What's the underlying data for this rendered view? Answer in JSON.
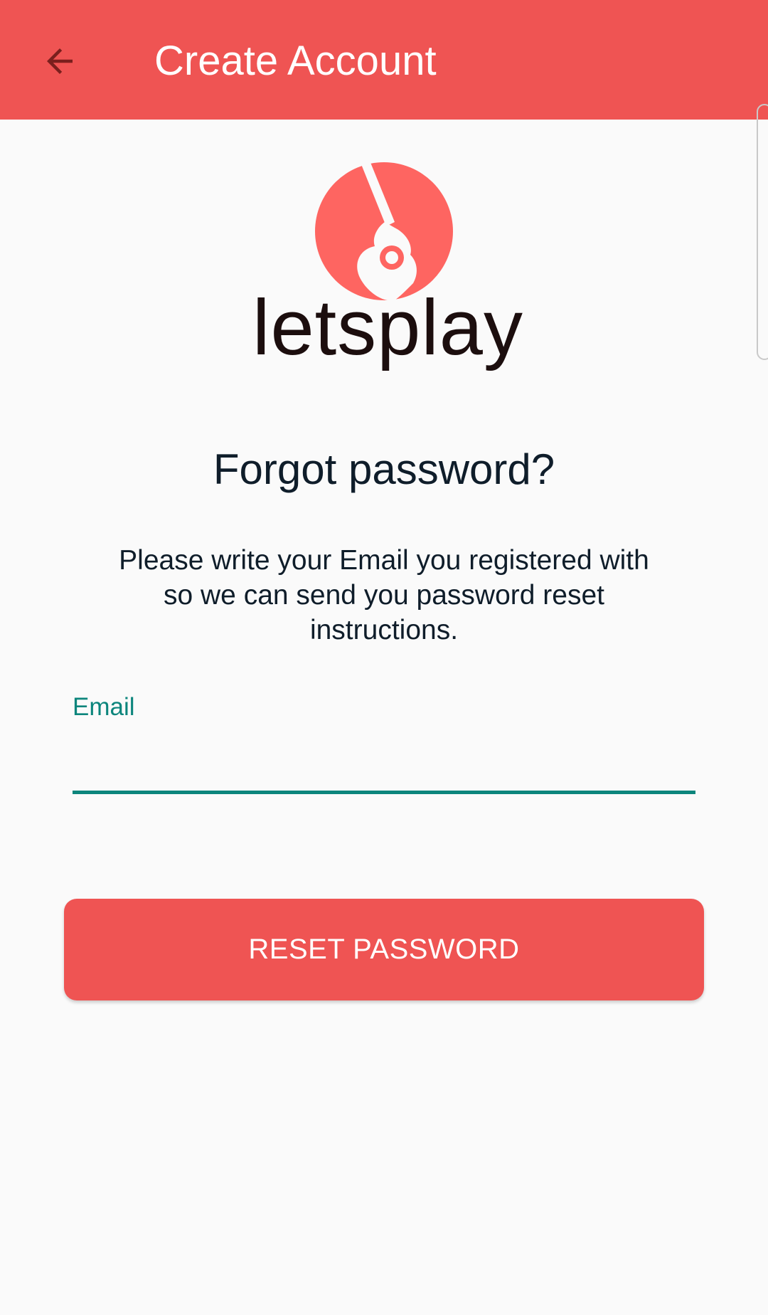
{
  "app_bar": {
    "title": "Create Account",
    "back_icon": "arrow-left-icon",
    "color": "#ef5453"
  },
  "logo": {
    "icon": "guitar-circle-icon",
    "wordmark": "letsplay",
    "circle_color": "#fe6561",
    "text_color": "#1c0e0e"
  },
  "content": {
    "heading": "Forgot password?",
    "instructions": "Please write your Email you registered with so we can send you password reset instructions."
  },
  "email_field": {
    "label": "Email",
    "value": "",
    "accent_color": "#0c857c"
  },
  "reset_button": {
    "label": "RESET PASSWORD",
    "color": "#ef5453"
  }
}
